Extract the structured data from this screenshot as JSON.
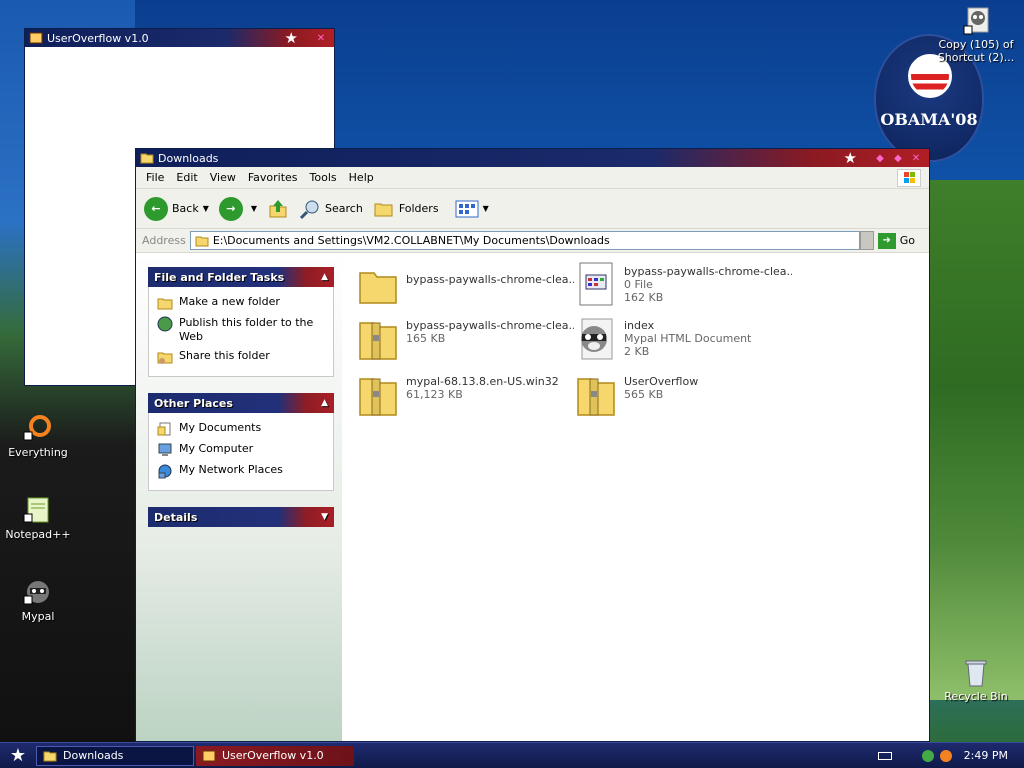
{
  "desktop": {
    "icons_left": [
      {
        "label": "Everything"
      },
      {
        "label": "Notepad++"
      },
      {
        "label": "Mypal"
      }
    ],
    "icon_top_right": {
      "label": "Copy (105) of Shortcut (2)..."
    },
    "recycle_bin": {
      "label": "Recycle Bin"
    },
    "obama_logo": {
      "text": "OBAMA'08"
    }
  },
  "userOverflow_window": {
    "title": "UserOverflow v1.0"
  },
  "explorer": {
    "title": "Downloads",
    "menu": [
      "File",
      "Edit",
      "View",
      "Favorites",
      "Tools",
      "Help"
    ],
    "toolbar": {
      "back": "Back",
      "search": "Search",
      "folders": "Folders"
    },
    "address": {
      "label": "Address",
      "value": "E:\\Documents and Settings\\VM2.COLLABNET\\My Documents\\Downloads",
      "go": "Go"
    },
    "panels": {
      "file_folder_tasks": {
        "title": "File and Folder Tasks",
        "items": [
          "Make a new folder",
          "Publish this folder to the Web",
          "Share this folder"
        ]
      },
      "other_places": {
        "title": "Other Places",
        "items": [
          "My Documents",
          "My Computer",
          "My Network Places"
        ]
      },
      "details": {
        "title": "Details"
      }
    },
    "files": [
      {
        "name": "bypass-paywalls-chrome-clea...",
        "sub1": "",
        "sub2": "",
        "kind": "folder"
      },
      {
        "name": "bypass-paywalls-chrome-clea...",
        "sub1": "0 File",
        "sub2": "162 KB",
        "kind": "file"
      },
      {
        "name": "bypass-paywalls-chrome-clea...",
        "sub1": "165 KB",
        "sub2": "",
        "kind": "zip"
      },
      {
        "name": "index",
        "sub1": "Mypal HTML Document",
        "sub2": "2 KB",
        "kind": "html"
      },
      {
        "name": "mypal-68.13.8.en-US.win32",
        "sub1": "61,123 KB",
        "sub2": "",
        "kind": "zip"
      },
      {
        "name": "UserOverflow",
        "sub1": "565 KB",
        "sub2": "",
        "kind": "zip"
      }
    ]
  },
  "taskbar": {
    "tasks": [
      "Downloads",
      "UserOverflow v1.0"
    ],
    "clock": "2:49 PM"
  }
}
